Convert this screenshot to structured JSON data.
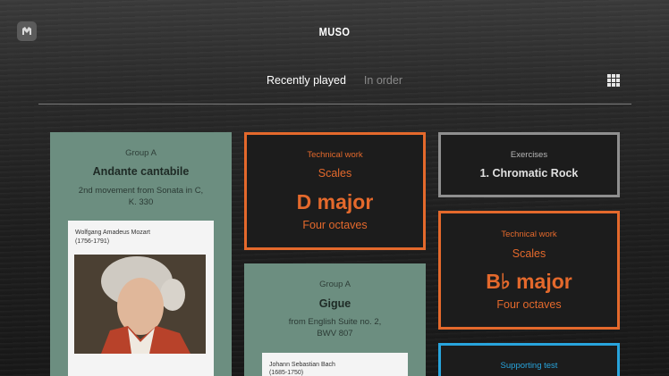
{
  "header": {
    "app_title": "MUSO",
    "logo_icon": "muso-logo-icon",
    "grid_icon": "grid-view-icon"
  },
  "tabs": [
    {
      "label": "Recently played",
      "active": true
    },
    {
      "label": "In order",
      "active": false
    }
  ],
  "cards": {
    "andante": {
      "category": "Group A",
      "title": "Andante cantabile",
      "subtitle": "2nd movement from Sonata in C, K. 330",
      "composer_name": "Wolfgang Amadeus Mozart",
      "composer_years": "(1756-1791)"
    },
    "d_major": {
      "category": "Technical work",
      "line1": "Scales",
      "key": "D major",
      "line3": "Four octaves"
    },
    "gigue": {
      "category": "Group A",
      "title": "Gigue",
      "subtitle": "from English Suite no. 2, BWV 807",
      "composer_name": "Johann Sebastian Bach",
      "composer_years": "(1685-1750)"
    },
    "exercises": {
      "category": "Exercises",
      "title": "1. Chromatic Rock"
    },
    "bflat_major": {
      "category": "Technical work",
      "line1": "Scales",
      "key": "B♭ major",
      "line3": "Four octaves"
    },
    "supporting": {
      "category": "Supporting test"
    }
  },
  "colors": {
    "green_card": "#6c8e80",
    "orange_accent": "#e4692c",
    "grey_accent": "#8f8f8f",
    "blue_accent": "#28a4dc"
  }
}
